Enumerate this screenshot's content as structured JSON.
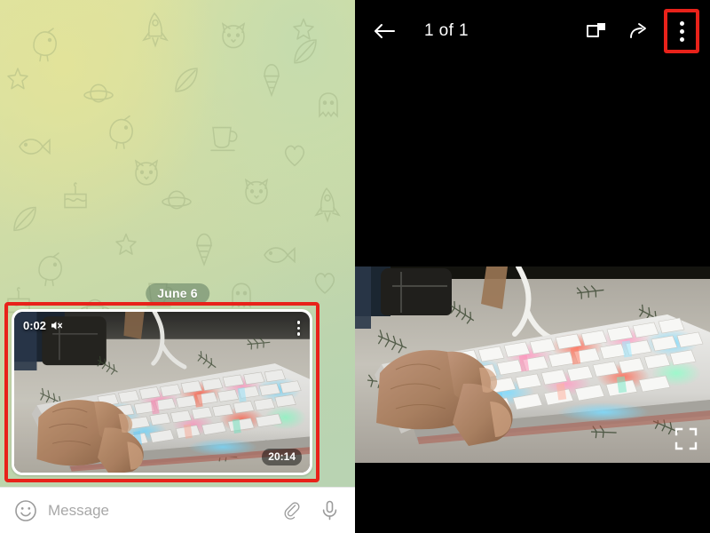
{
  "app": {
    "name": "Telegram",
    "screen_kind": "chat-and-media-viewer"
  },
  "chat": {
    "date_separator": "June 6",
    "message": {
      "type": "video",
      "duration": "0:02",
      "muted": true,
      "mute_icon": "speaker-muted-icon",
      "kebab_icon": "more-options-icon",
      "sent_time": "20:14",
      "media_description": "Hand typing on a white RGB-backlit mechanical keyboard on a leaf-patterned table cloth, dark speaker at upper left",
      "highlight_color": "#e8221a"
    },
    "composer": {
      "emoji_icon": "smiley-icon",
      "placeholder": "Message",
      "value": "",
      "attach_icon": "paperclip-icon",
      "voice_icon": "microphone-icon"
    },
    "wallpaper": {
      "style": "telegram-doodle-pattern",
      "gradient_from": "#dfe3a0",
      "gradient_to": "#b6d2b1"
    }
  },
  "viewer": {
    "topbar": {
      "back_icon": "back-arrow-icon",
      "counter": "1 of 1",
      "pip_icon": "picture-in-picture-icon",
      "share_icon": "share-forward-icon",
      "menu_icon": "more-options-icon",
      "menu_highlighted": true,
      "highlight_color": "#e8221a",
      "background": "#000000"
    },
    "player": {
      "fullscreen_icon": "fullscreen-expand-icon",
      "media_description": "Hand typing on a white RGB-backlit mechanical keyboard on a leaf-patterned table cloth, dark speaker at upper left",
      "letterbox_color": "#000000"
    }
  }
}
